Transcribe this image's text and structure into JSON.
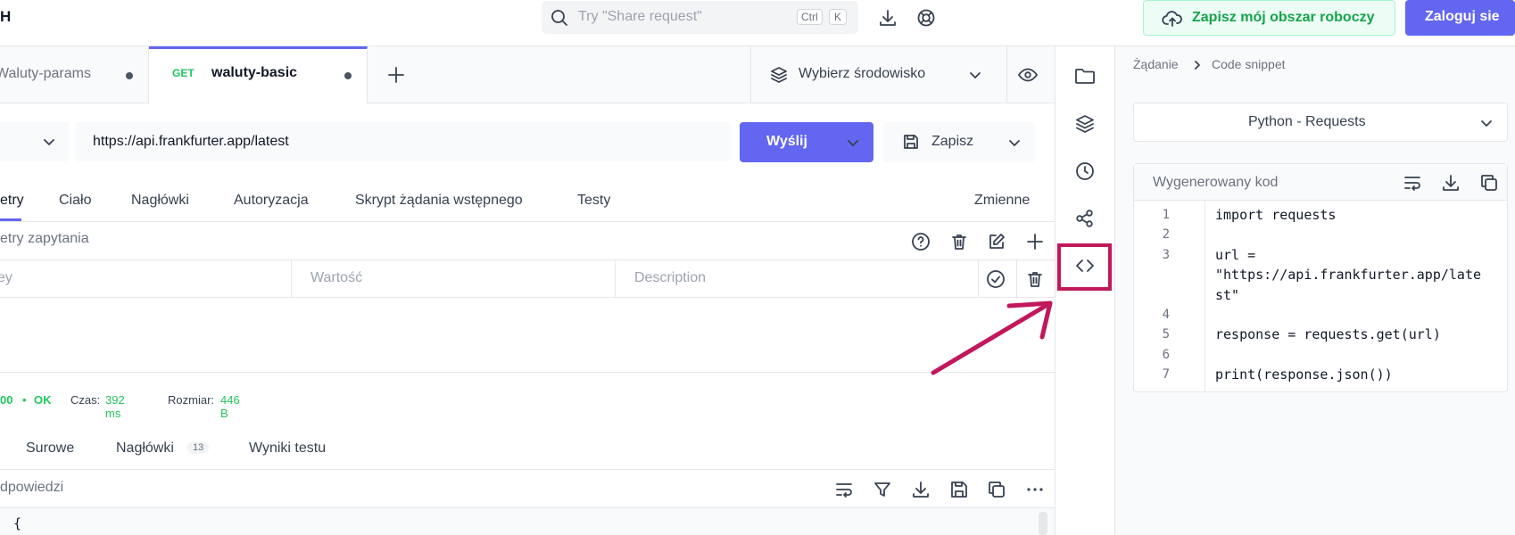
{
  "app": {
    "title_fragment": "H"
  },
  "search": {
    "placeholder": "Try \"Share request\"",
    "key1": "Ctrl",
    "key2": "K"
  },
  "header": {
    "save_workspace": "Zapisz mój obszar roboczy",
    "login": "Zaloguj sie"
  },
  "tabs": [
    {
      "label": "Waluty-params"
    },
    {
      "method": "GET",
      "label": "waluty-basic"
    }
  ],
  "environment": {
    "label": "Wybierz środowisko"
  },
  "request": {
    "url": "https://api.frankfurter.app/latest",
    "send": "Wyślij",
    "save": "Zapisz"
  },
  "request_tabs": [
    "etry",
    "Ciało",
    "Nagłówki",
    "Autoryzacja",
    "Skrypt żądania wstępnego",
    "Testy"
  ],
  "variables": "Zmienne",
  "params": {
    "title": "etry zapytania",
    "key_placeholder": "ey",
    "value_placeholder": "Wartość",
    "desc_placeholder": "Description"
  },
  "status": {
    "code": "00",
    "sep": "•",
    "text": "OK",
    "time_label": "Czas:",
    "time_value": "392 ms",
    "size_label": "Rozmiar:",
    "size_value": "446 B"
  },
  "response_tabs": {
    "raw": "Surowe",
    "headers": "Nagłówki",
    "headers_count": "13",
    "tests": "Wyniki testu"
  },
  "response": {
    "title": "dpowiedzi",
    "first_line": "{"
  },
  "breadcrumb": {
    "parent": "Żądanie",
    "sep": ">",
    "current": "Code snippet"
  },
  "snippet": {
    "language": "Python - Requests",
    "header": "Wygenerowany kod",
    "lines": [
      {
        "no": "1",
        "code": "import requests"
      },
      {
        "no": "2",
        "code": ""
      },
      {
        "no": "3",
        "code": "url ="
      },
      {
        "no": "",
        "code": "\"https://api.frankfurter.app/late"
      },
      {
        "no": "",
        "code": "st\""
      },
      {
        "no": "4",
        "code": ""
      },
      {
        "no": "5",
        "code": "response = requests.get(url)"
      },
      {
        "no": "6",
        "code": ""
      },
      {
        "no": "7",
        "code": "print(response.json())"
      }
    ]
  },
  "colors": {
    "accent": "#6366f1",
    "ok_green": "#22c55e",
    "danger": "#ef4444",
    "annotation": "#c2185b"
  }
}
